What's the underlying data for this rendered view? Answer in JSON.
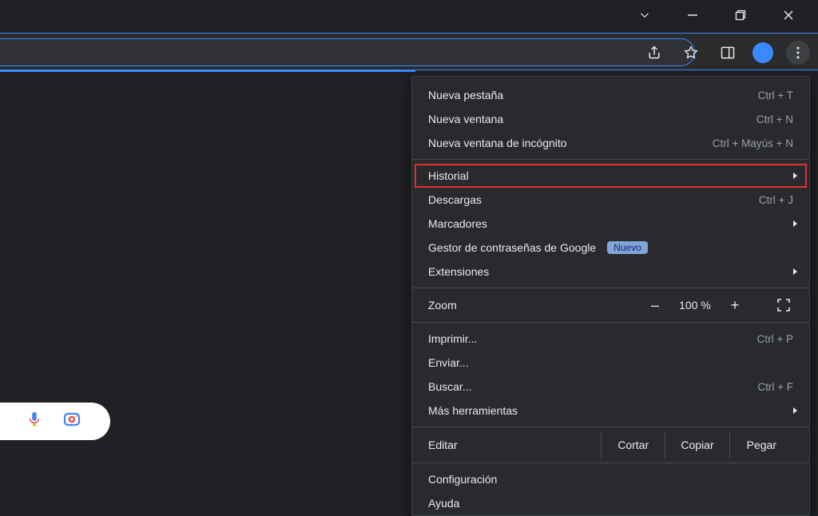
{
  "menu": {
    "new_tab": {
      "label": "Nueva pestaña",
      "shortcut": "Ctrl + T"
    },
    "new_window": {
      "label": "Nueva ventana",
      "shortcut": "Ctrl + N"
    },
    "incognito": {
      "label": "Nueva ventana de incógnito",
      "shortcut": "Ctrl + Mayús + N"
    },
    "history": {
      "label": "Historial"
    },
    "downloads": {
      "label": "Descargas",
      "shortcut": "Ctrl + J"
    },
    "bookmarks": {
      "label": "Marcadores"
    },
    "passwords": {
      "label": "Gestor de contraseñas de Google",
      "badge": "Nuevo"
    },
    "extensions": {
      "label": "Extensiones"
    },
    "zoom": {
      "label": "Zoom",
      "value": "100 %",
      "minus": "–",
      "plus": "+"
    },
    "print": {
      "label": "Imprimir...",
      "shortcut": "Ctrl + P"
    },
    "send": {
      "label": "Enviar..."
    },
    "find": {
      "label": "Buscar...",
      "shortcut": "Ctrl + F"
    },
    "more_tools": {
      "label": "Más herramientas"
    },
    "edit": {
      "label": "Editar",
      "cut": "Cortar",
      "copy": "Copiar",
      "paste": "Pegar"
    },
    "settings": {
      "label": "Configuración"
    },
    "help": {
      "label": "Ayuda"
    }
  }
}
